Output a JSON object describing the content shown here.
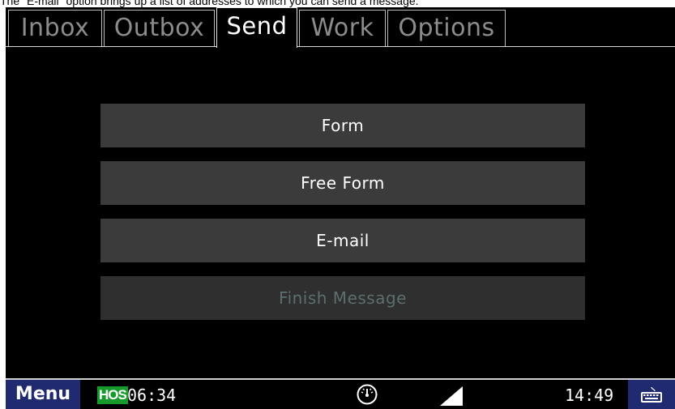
{
  "caption": "The \"E-mail\" option brings up a list of addresses to which you can send a message.",
  "tabs": [
    {
      "label": "Inbox",
      "active": false
    },
    {
      "label": "Outbox",
      "active": false
    },
    {
      "label": "Send",
      "active": true
    },
    {
      "label": "Work",
      "active": false
    },
    {
      "label": "Options",
      "active": false
    }
  ],
  "send_menu": [
    {
      "label": "Form",
      "enabled": true
    },
    {
      "label": "Free Form",
      "enabled": true
    },
    {
      "label": "E-mail",
      "enabled": true
    },
    {
      "label": "Finish Message",
      "enabled": false
    }
  ],
  "statusbar": {
    "menu_label": "Menu",
    "hos_label": "HOS",
    "hos_time": "06:34",
    "clock": "14:49",
    "icons": [
      "gauge-icon",
      "signal-icon",
      "keyboard-icon"
    ]
  },
  "colors": {
    "tab_active_text": "#ffffff",
    "tab_inactive_text": "#8c8c8c",
    "button_bg": "#3b3b3b",
    "disabled_text": "#5c6e6e",
    "menu_key_bg": "#202a70",
    "hos_badge_bg": "#169a2c"
  }
}
